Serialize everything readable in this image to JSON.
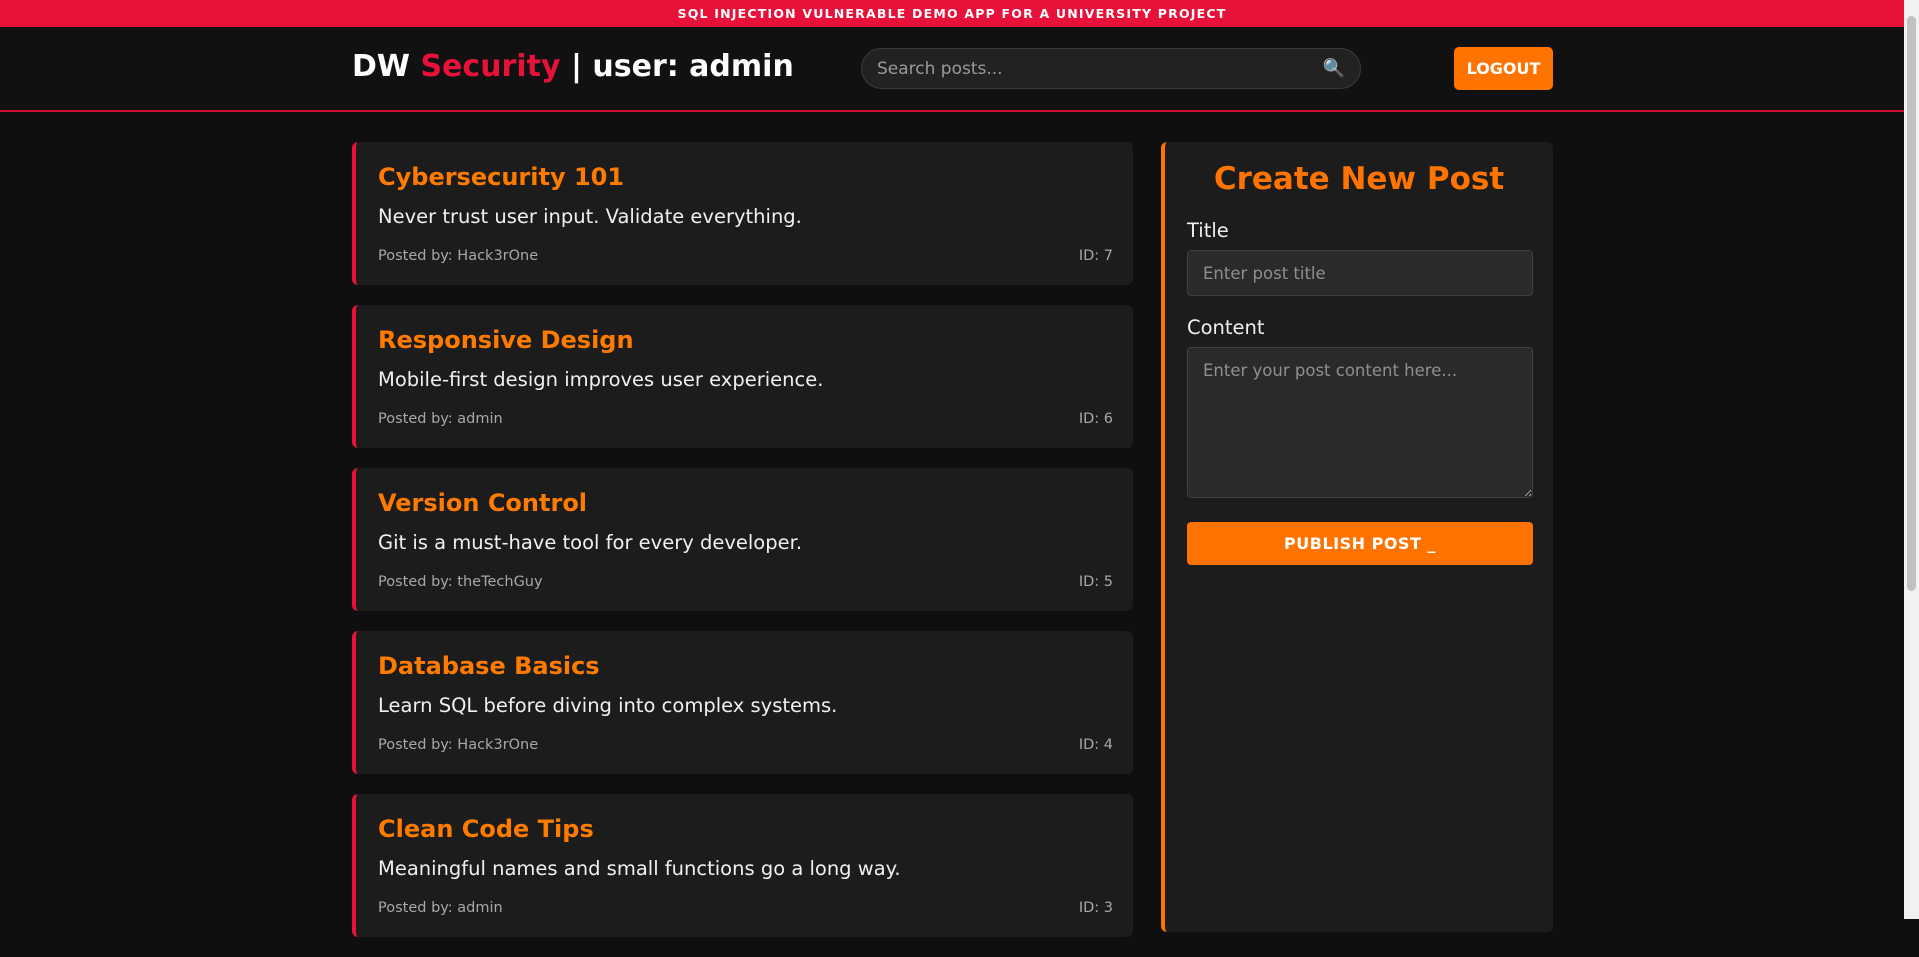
{
  "banner": {
    "text": "SQL INJECTION VULNERABLE DEMO APP FOR A UNIVERSITY PROJECT"
  },
  "header": {
    "brand_prefix": "DW",
    "brand_accent": "Security",
    "brand_user": "| user: admin",
    "search_placeholder": "Search posts...",
    "search_icon": "🔍",
    "logout_label": "LOGOUT"
  },
  "posts": [
    {
      "title": "Cybersecurity 101",
      "content": "Never trust user input. Validate everything.",
      "author": "Posted by: Hack3rOne",
      "id": "ID: 7"
    },
    {
      "title": "Responsive Design",
      "content": "Mobile-first design improves user experience.",
      "author": "Posted by: admin",
      "id": "ID: 6"
    },
    {
      "title": "Version Control",
      "content": "Git is a must-have tool for every developer.",
      "author": "Posted by: theTechGuy",
      "id": "ID: 5"
    },
    {
      "title": "Database Basics",
      "content": "Learn SQL before diving into complex systems.",
      "author": "Posted by: Hack3rOne",
      "id": "ID: 4"
    },
    {
      "title": "Clean Code Tips",
      "content": "Meaningful names and small functions go a long way.",
      "author": "Posted by: admin",
      "id": "ID: 3"
    }
  ],
  "create_post": {
    "heading": "Create New Post",
    "title_label": "Title",
    "title_placeholder": "Enter post title",
    "content_label": "Content",
    "content_placeholder": "Enter your post content here...",
    "publish_label": "PUBLISH POST _"
  },
  "colors": {
    "accent_red": "#e8113a",
    "accent_orange": "#ff7400",
    "background": "#0f0f0f",
    "card": "#1c1c1c"
  }
}
